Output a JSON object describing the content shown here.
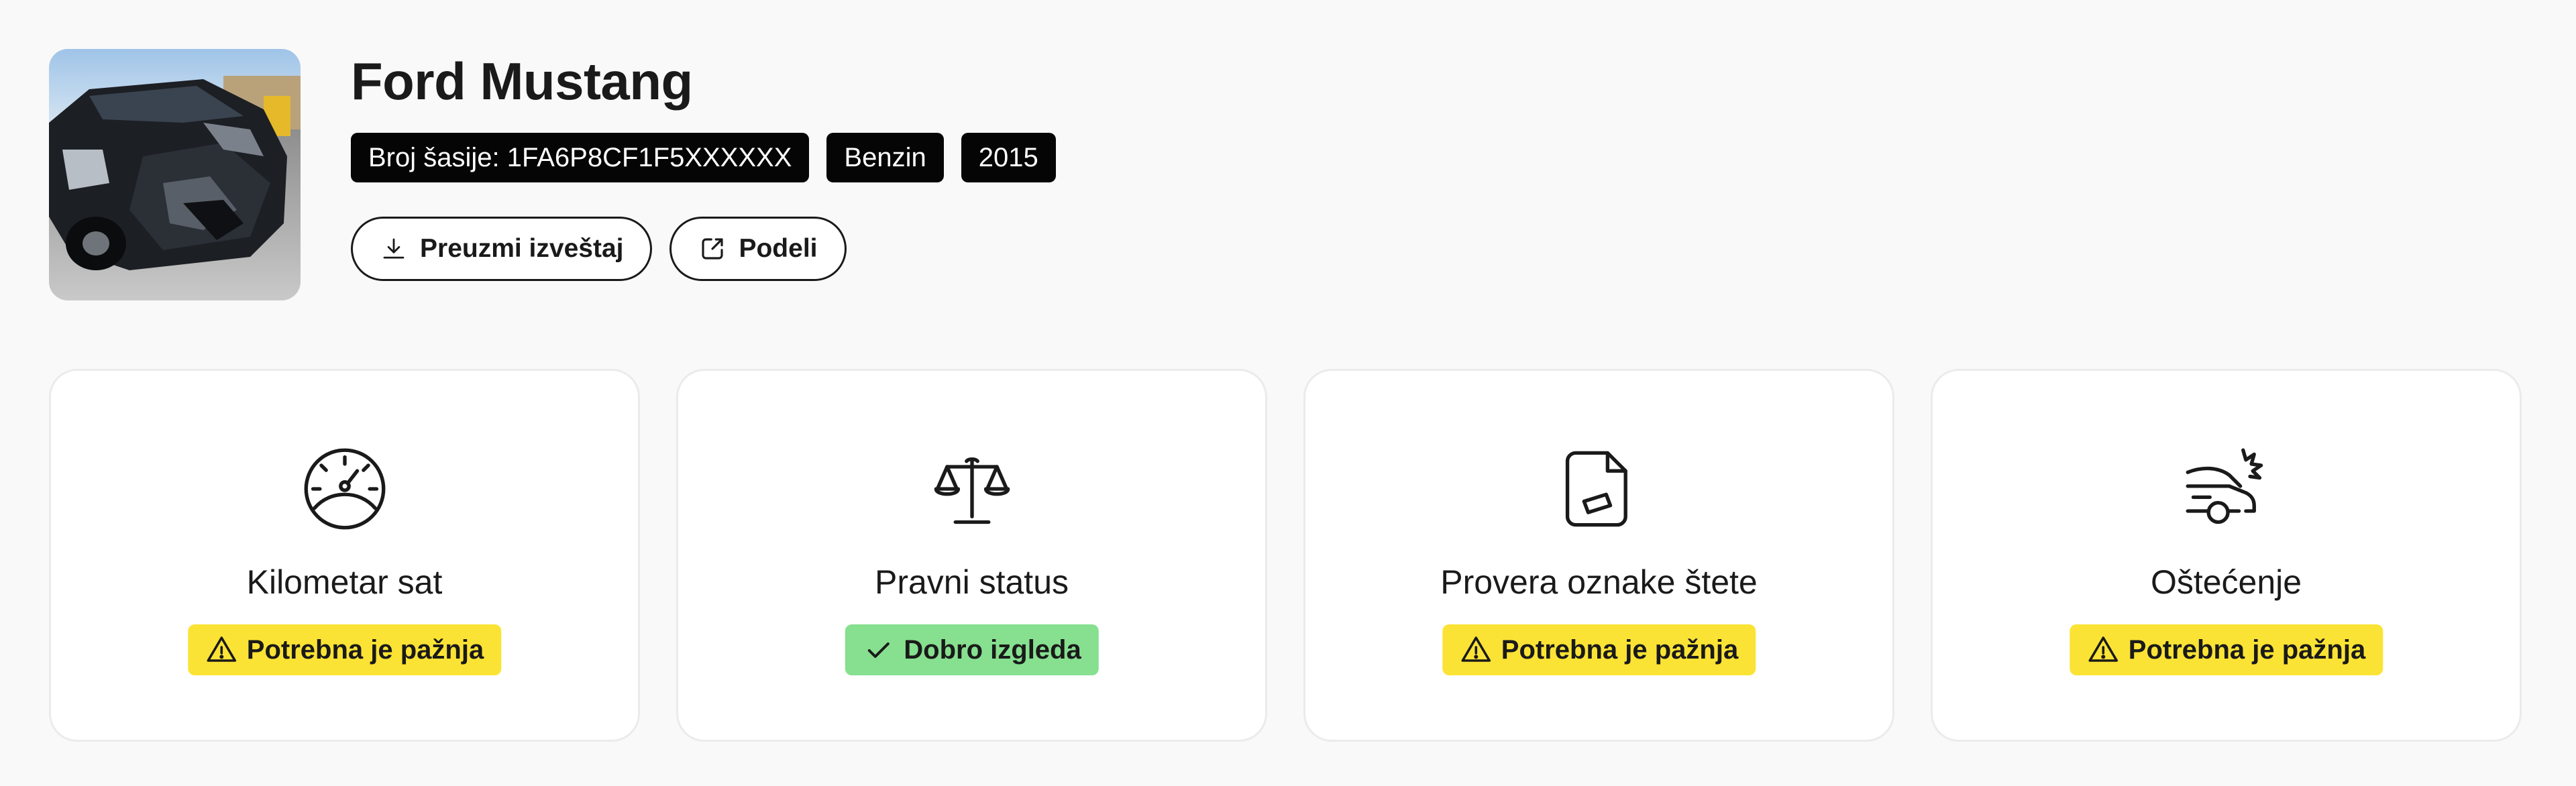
{
  "vehicle": {
    "title": "Ford Mustang",
    "tags": [
      "Broj šasije: 1FA6P8CF1F5XXXXXX",
      "Benzin",
      "2015"
    ]
  },
  "actions": {
    "download_label": "Preuzmi izveštaj",
    "download_icon": "download-icon",
    "share_label": "Podeli",
    "share_icon": "share-icon"
  },
  "cards": [
    {
      "title": "Kilometar sat",
      "icon": "speedometer-icon",
      "status": "Potrebna je pažnja",
      "status_type": "warning"
    },
    {
      "title": "Pravni status",
      "icon": "scales-icon",
      "status": "Dobro izgleda",
      "status_type": "ok"
    },
    {
      "title": "Provera oznake štete",
      "icon": "document-tag-icon",
      "status": "Potrebna je pažnja",
      "status_type": "warning"
    },
    {
      "title": "Oštećenje",
      "icon": "car-crash-icon",
      "status": "Potrebna je pažnja",
      "status_type": "warning"
    }
  ],
  "colors": {
    "warning": "#fbe335",
    "ok": "#86e08f",
    "tag_bg": "#050505"
  }
}
